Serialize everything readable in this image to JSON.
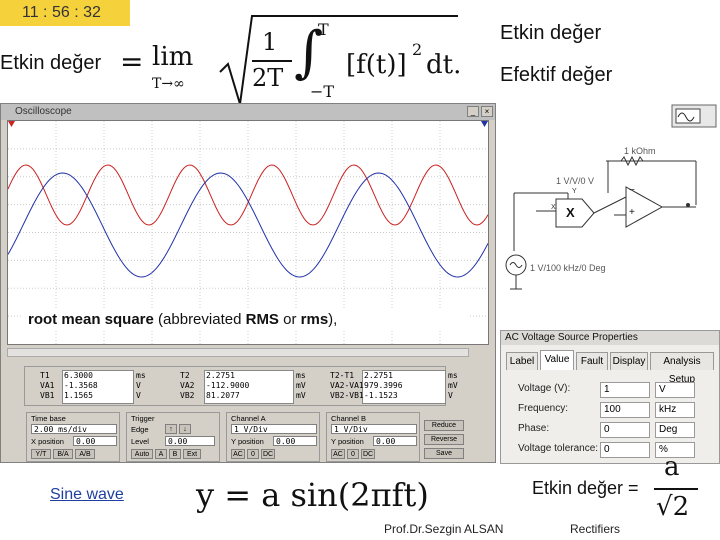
{
  "clock": "11 : 56 : 32",
  "header": {
    "left_label": "Etkin değer",
    "right_label_1": "Etkin değer",
    "right_label_2": "Efektif değer",
    "formula_lhs": "=",
    "formula_lim": "lim",
    "formula_lim_sub": "T→∞",
    "formula_frac_num": "1",
    "formula_frac_den": "2T",
    "formula_int_upper": "T",
    "formula_int_lower": "−T",
    "formula_integrand": "[f(t)]",
    "formula_power": "2",
    "formula_dt": "dt."
  },
  "oscilloscope": {
    "title": "Oscilloscope",
    "rms_prefix": "root mean square",
    "rms_mid": " (abbreviated ",
    "rms_abbr1": "RMS",
    "rms_or": " or ",
    "rms_abbr2": "rms",
    "rms_suffix": "),",
    "readouts": {
      "col1_labels": [
        "T1",
        "VA1",
        "VB1"
      ],
      "col1_values": [
        "6.3000",
        "-1.3568",
        "1.1565"
      ],
      "col1_units": [
        "ms",
        "V",
        "V"
      ],
      "col2_labels": [
        "T2",
        "VA2",
        "VB2"
      ],
      "col2_values": [
        "2.2751",
        "-112.9000",
        "81.2077"
      ],
      "col2_units": [
        "ms",
        "mV",
        "mV"
      ],
      "col3_labels": [
        "T2-T1",
        "VA2-VA1",
        "VB2-VB1"
      ],
      "col3_values": [
        "2.2751",
        "979.3996",
        "-1.1523"
      ],
      "col3_units": [
        "ms",
        "mV",
        "V"
      ]
    },
    "timebase": {
      "title": "Time base",
      "scale": "2.00 ms/div",
      "xpos_label": "X position",
      "xpos": "0.00",
      "btns": [
        "Y/T",
        "B/A",
        "A/B"
      ]
    },
    "trigger": {
      "title": "Trigger",
      "edge_label": "Edge",
      "level_label": "Level",
      "level": "0.00",
      "btns": [
        "Auto",
        "A",
        "B",
        "Ext"
      ]
    },
    "channel_a": {
      "title": "Channel A",
      "scale": "1 V/Div",
      "ypos_label": "Y position",
      "ypos": "0.00",
      "btns": [
        "AC",
        "0",
        "DC"
      ]
    },
    "channel_b": {
      "title": "Channel B",
      "scale": "1 V/Div",
      "ypos_label": "Y position",
      "ypos": "0.00",
      "btns": [
        "AC",
        "0",
        "DC"
      ]
    },
    "side_btns": [
      "Reduce",
      "Reverse",
      "Save"
    ]
  },
  "circuit": {
    "resistor": "1 kOhm",
    "multiplier": "1 V/V/0 V",
    "source": "1 V/100 kHz/0 Deg",
    "y_label": "Y",
    "x_label": "X",
    "mult_symbol": "X",
    "plus": "+",
    "minus": "−"
  },
  "ac_dialog": {
    "title": "AC Voltage Source Properties",
    "tabs": [
      "Label",
      "Value",
      "Fault",
      "Display",
      "Analysis Setup"
    ],
    "rows": [
      {
        "label": "Voltage (V):",
        "value": "1",
        "unit": "V"
      },
      {
        "label": "Frequency:",
        "value": "100",
        "unit": "kHz"
      },
      {
        "label": "Phase:",
        "value": "0",
        "unit": "Deg"
      },
      {
        "label": "Voltage tolerance:",
        "value": "0",
        "unit": "%"
      }
    ]
  },
  "footer": {
    "sine_wave": "Sine wave",
    "formula_y": "y = a sin(2πft)",
    "rms_result_label": "Etkin değer =",
    "rms_num": "a",
    "rms_den": "√2",
    "author": "Prof.Dr.Sezgin ALSAN",
    "topic": "Rectifiers"
  },
  "colors": {
    "trace_a": "#cc2222",
    "trace_b": "#2233aa",
    "link": "#1f3fa0",
    "clock_bg": "#f5d23c"
  }
}
